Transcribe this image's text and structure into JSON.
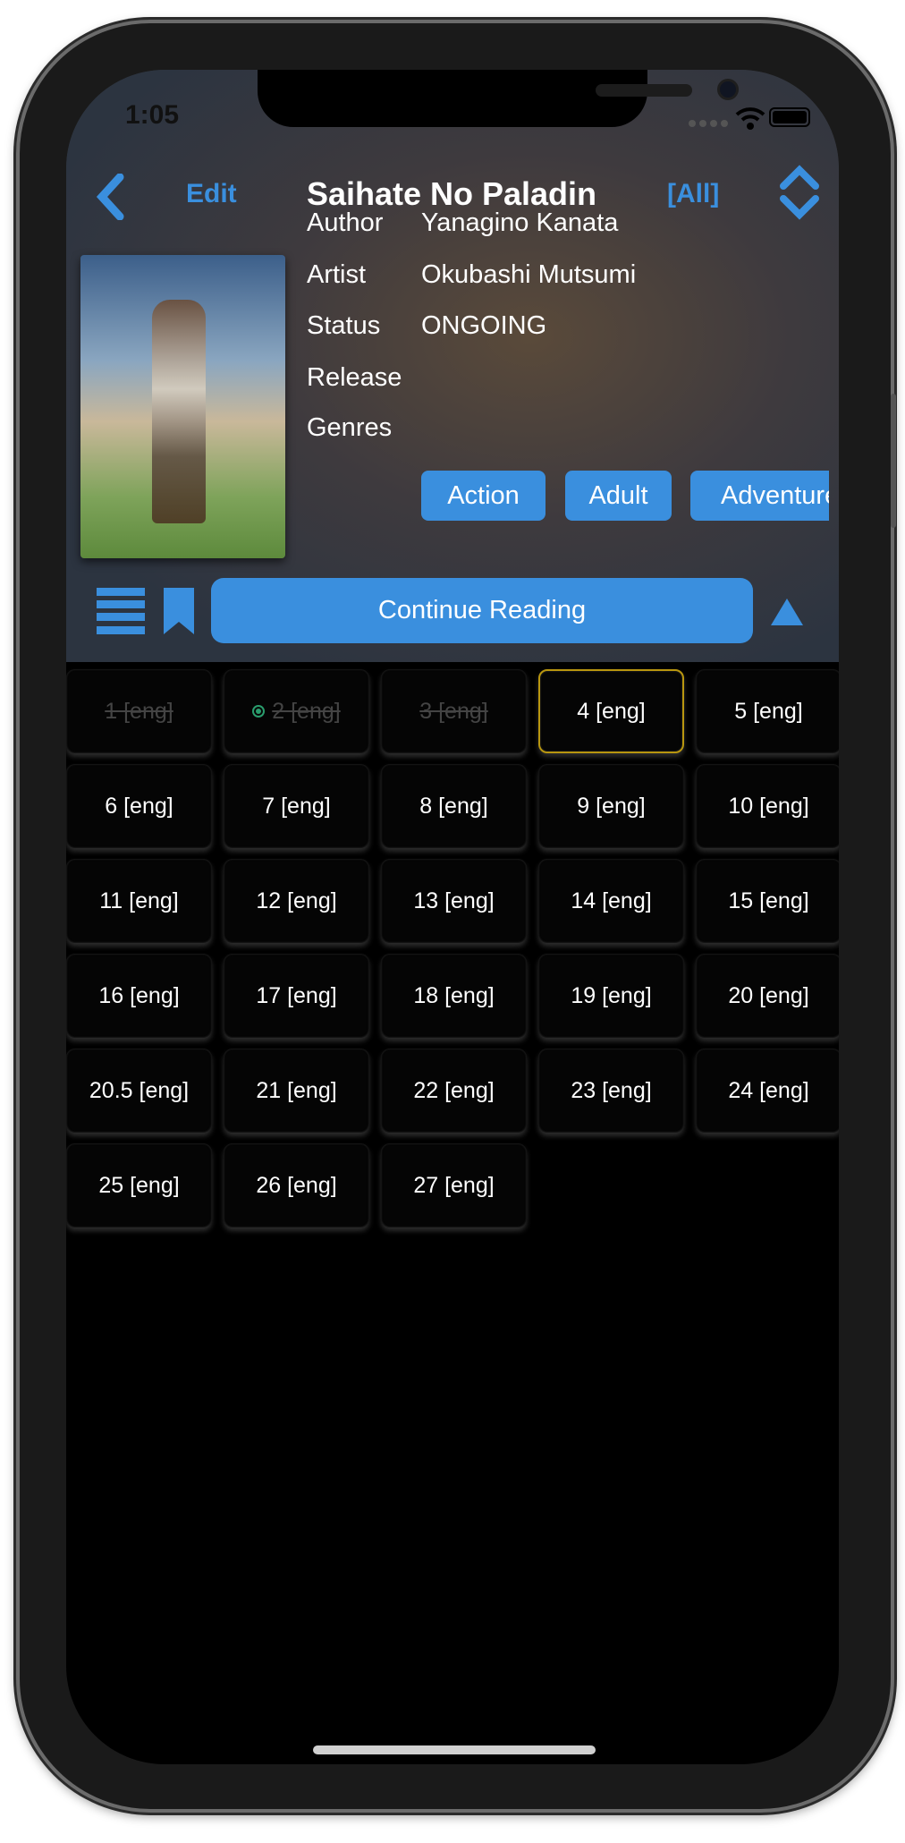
{
  "status_bar": {
    "time": "1:05",
    "signal": "signal-dots-icon",
    "wifi": "wifi-icon",
    "battery": "battery-icon"
  },
  "nav": {
    "back_icon": "chevron-left-icon",
    "edit_label": "Edit",
    "title": "Saihate No Paladin",
    "filter_label": "[All]",
    "sort_icon": "chevron-up-down-icon"
  },
  "details": {
    "rows": [
      {
        "label": "Author",
        "value": "Yanagino Kanata"
      },
      {
        "label": "Artist",
        "value": "Okubashi Mutsumi"
      },
      {
        "label": "Status",
        "value": "ONGOING"
      },
      {
        "label": "Release",
        "value": ""
      }
    ],
    "genres_label": "Genres",
    "genres": [
      "Action",
      "Adult",
      "Adventure"
    ]
  },
  "actions": {
    "list_icon": "list-icon",
    "bookmark_icon": "bookmark-icon",
    "continue_label": "Continue Reading",
    "scroll_top_icon": "triangle-up-icon"
  },
  "colors": {
    "accent": "#3a8fde",
    "current_border": "#b8960f",
    "in_progress": "#2a9d6d"
  },
  "chapters": [
    {
      "label": "1 [eng]",
      "state": "read"
    },
    {
      "label": "2 [eng]",
      "state": "read-inprogress"
    },
    {
      "label": "3 [eng]",
      "state": "read"
    },
    {
      "label": "4 [eng]",
      "state": "current"
    },
    {
      "label": "5 [eng]",
      "state": "unread"
    },
    {
      "label": "6 [eng]",
      "state": "unread"
    },
    {
      "label": "7 [eng]",
      "state": "unread"
    },
    {
      "label": "8 [eng]",
      "state": "unread"
    },
    {
      "label": "9 [eng]",
      "state": "unread"
    },
    {
      "label": "10 [eng]",
      "state": "unread"
    },
    {
      "label": "11 [eng]",
      "state": "unread"
    },
    {
      "label": "12 [eng]",
      "state": "unread"
    },
    {
      "label": "13 [eng]",
      "state": "unread"
    },
    {
      "label": "14 [eng]",
      "state": "unread"
    },
    {
      "label": "15 [eng]",
      "state": "unread"
    },
    {
      "label": "16 [eng]",
      "state": "unread"
    },
    {
      "label": "17 [eng]",
      "state": "unread"
    },
    {
      "label": "18 [eng]",
      "state": "unread"
    },
    {
      "label": "19 [eng]",
      "state": "unread"
    },
    {
      "label": "20 [eng]",
      "state": "unread"
    },
    {
      "label": "20.5 [eng]",
      "state": "unread"
    },
    {
      "label": "21 [eng]",
      "state": "unread"
    },
    {
      "label": "22 [eng]",
      "state": "unread"
    },
    {
      "label": "23 [eng]",
      "state": "unread"
    },
    {
      "label": "24 [eng]",
      "state": "unread"
    },
    {
      "label": "25 [eng]",
      "state": "unread"
    },
    {
      "label": "26 [eng]",
      "state": "unread"
    },
    {
      "label": "27 [eng]",
      "state": "unread"
    }
  ]
}
